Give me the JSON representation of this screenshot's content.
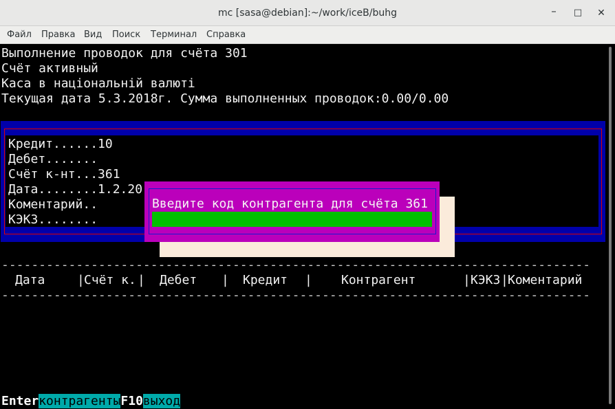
{
  "window": {
    "title": "mc [sasa@debian]:~/work/iceB/buhg",
    "minimize_glyph": "–",
    "maximize_glyph": "□",
    "close_glyph": "✕"
  },
  "menu": {
    "items": [
      {
        "label": "Файл"
      },
      {
        "label": "Правка"
      },
      {
        "label": "Вид"
      },
      {
        "label": "Поиск"
      },
      {
        "label": "Терминал"
      },
      {
        "label": "Справка"
      }
    ]
  },
  "terminal": {
    "lines": [
      "Выполнение проводок для счёта 301",
      "Счёт активный",
      "Каса в національній валюті",
      "Текущая дата 5.3.2018г. Сумма выполненных проводок:0.00/0.00"
    ]
  },
  "form": {
    "fields": [
      "Кредит......10",
      "Дебет.......",
      "Счёт к-нт...361",
      "Дата........1.2.20",
      "Коментарий..",
      "КЭКЗ........"
    ]
  },
  "dialog": {
    "prompt": "Введите код контрагента для счёта 361",
    "value": ""
  },
  "table": {
    "dashes": "--------------------------------------------------------------------------------",
    "columns": [
      {
        "label": "Дата"
      },
      {
        "label": "Счёт к."
      },
      {
        "label": "Дебет"
      },
      {
        "label": "Кредит"
      },
      {
        "label": "Контрагент"
      },
      {
        "label": "КЭКЗ"
      },
      {
        "label": "Коментарий"
      }
    ],
    "separator": "|"
  },
  "function_keys": [
    {
      "key": "Enter",
      "label": "контрагенты"
    },
    {
      "key": "F10",
      "label": "выход"
    }
  ],
  "colors": {
    "terminal_bg": "#000000",
    "form_blue": "#0000aa",
    "form_border": "#e00000",
    "dialog_magenta": "#bb00bb",
    "input_green": "#00c000",
    "fkey_cyan": "#00aaaa"
  }
}
